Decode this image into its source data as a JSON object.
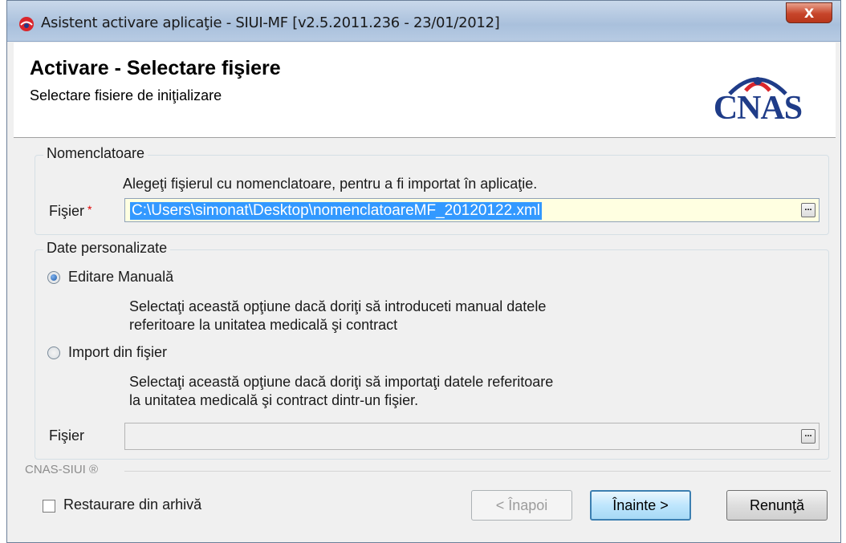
{
  "window": {
    "title": "Asistent activare aplicaţie - SIUI-MF [v2.5.2011.236 - 23/01/2012]",
    "close_label": "X"
  },
  "header": {
    "title": "Activare - Selectare fişiere",
    "subtitle": "Selectare fisiere de iniţializare",
    "logo_text": "CNAS"
  },
  "nomenclatoare": {
    "legend": "Nomenclatoare",
    "instruction": "Alegeţi fişierul cu nomenclatoare, pentru a fi importat în aplicaţie.",
    "file_label": "Fişier",
    "required_mark": "*",
    "file_value": "C:\\Users\\simonat\\Desktop\\nomenclatoareMF_20120122.xml",
    "browse_label": "..."
  },
  "date_personalizate": {
    "legend": "Date personalizate",
    "option_manual": {
      "label": "Editare Manuală",
      "checked": true,
      "description_line1": "Selectaţi această opţiune dacă doriţi să introduceti manual datele",
      "description_line2": "referitoare la unitatea medicală şi contract"
    },
    "option_import": {
      "label": "Import din fişier",
      "checked": false,
      "description_line1": "Selectaţi această opţiune dacă doriţi să importaţi datele referitoare",
      "description_line2": "la unitatea medicală şi contract dintr-un fişier."
    },
    "file_label": "Fişier",
    "file_value": "",
    "browse_label": "..."
  },
  "footer": {
    "legend": "CNAS-SIUI ®",
    "restore_label": "Restaurare din arhivă",
    "restore_checked": false,
    "back_label": "< Înapoi",
    "next_label": "Înainte >",
    "cancel_label": "Renunţă"
  },
  "colors": {
    "selection": "#3399ff",
    "required": "#e00000",
    "logo": "#1f3c88"
  }
}
